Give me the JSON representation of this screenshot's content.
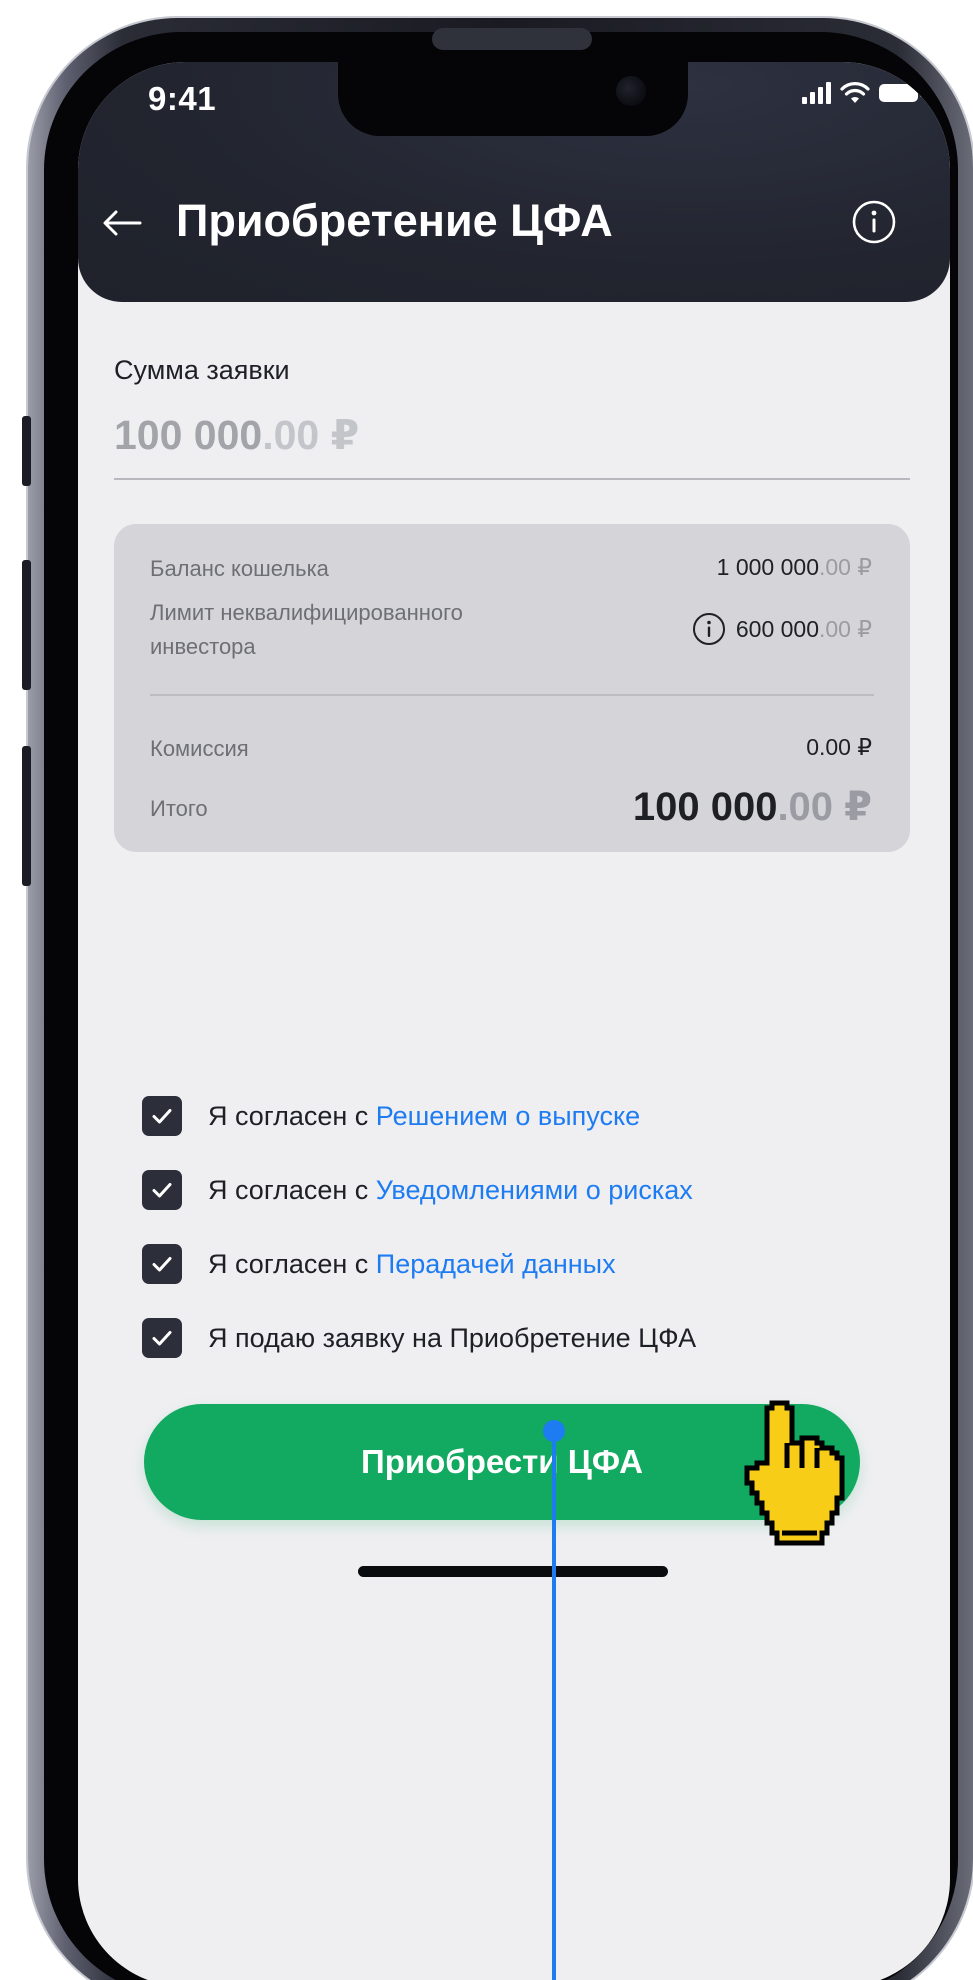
{
  "status_bar": {
    "time": "9:41",
    "icons": [
      "signal-icon",
      "wifi-icon",
      "battery-icon"
    ]
  },
  "header": {
    "title": "Приобретение ЦФА",
    "back_icon": "arrow-left-icon",
    "info_icon": "info-icon"
  },
  "amount": {
    "label": "Сумма заявки",
    "integer": "100 000",
    "fraction": ".00 ₽"
  },
  "summary": {
    "wallet_balance": {
      "label": "Баланс кошелька",
      "integer": "1 000 000",
      "fraction": ".00 ₽"
    },
    "investor_limit": {
      "label_line1": "Лимит неквалифицированного",
      "label_line2": "инвестора",
      "integer": "600 000",
      "fraction": ".00 ₽"
    },
    "commission": {
      "label": "Комиссия",
      "value": "0.00 ₽"
    },
    "total": {
      "label": "Итого",
      "integer": "100 000",
      "fraction": ".00 ₽"
    }
  },
  "agreements": [
    {
      "prefix": "Я согласен с ",
      "link": "Решением о выпуске",
      "checked": true
    },
    {
      "prefix": "Я согласен с ",
      "link": "Уведомлениями о рисках",
      "checked": true
    },
    {
      "prefix": "Я согласен с ",
      "link": "Перадачей данных",
      "checked": true
    },
    {
      "prefix": "Я подаю заявку на Приобретение ЦФА",
      "link": "",
      "checked": true
    }
  ],
  "cta": {
    "label": "Приобрести ЦФА"
  },
  "colors": {
    "header_bg": "#22252f",
    "screen_bg": "#efeff1",
    "card_bg": "#d5d5d9",
    "accent_green": "#12a961",
    "link_blue": "#1e7cf2",
    "checkbox_bg": "#2c2f3a"
  }
}
